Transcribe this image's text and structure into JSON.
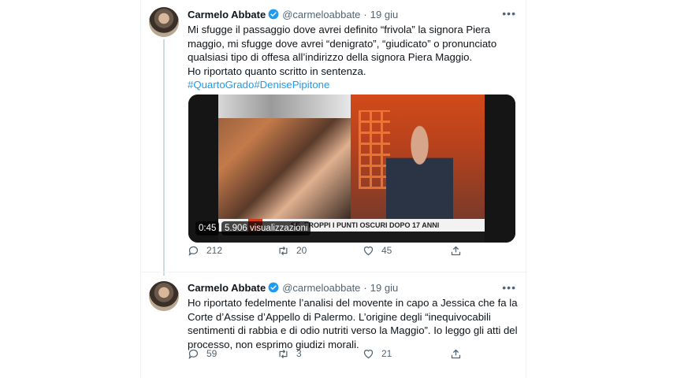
{
  "colors": {
    "accent": "#1d9bf0",
    "text": "#0f1419",
    "muted": "#536471"
  },
  "tweets": [
    {
      "author": {
        "name": "Carmelo Abbate",
        "handle": "@carmeloabbate",
        "verified": true
      },
      "date": "19 giu",
      "separator": "·",
      "more": "•••",
      "text_lines": [
        "Mi sfugge il passaggio dove avrei definito “frivola” la signora Piera",
        "maggio, mi sfugge dove avrei “denigrato”, “giudicato” o pronunciato",
        "qualsiasi tipo di offesa all’indirizzo della signora Piera Maggio.",
        "Ho riportato quanto scritto in sentenza."
      ],
      "hashtags": [
        "#QuartoGrado",
        "#DenisePipitone"
      ],
      "video": {
        "duration": "0:45",
        "views": "5.906 visualizzazioni",
        "banner": "SE, TROPPI I PUNTI OSCURI DOPO 17 ANNI"
      },
      "stats": {
        "replies": "212",
        "retweets": "20",
        "likes": "45"
      }
    },
    {
      "author": {
        "name": "Carmelo Abbate",
        "handle": "@carmeloabbate",
        "verified": true
      },
      "date": "19 giu",
      "separator": "·",
      "more": "•••",
      "text_lines": [
        "Ho riportato fedelmente l’analisi del movente in capo a Jessica che fa la",
        "Corte d’Assise d’Appello di Palermo. L’origine degli “inequivocabili",
        "sentimenti di rabbia e di odio nutriti verso la Maggio”. Io leggo gli atti del",
        "processo, non esprimo giudizi morali."
      ],
      "stats": {
        "replies": "59",
        "retweets": "3",
        "likes": "21"
      }
    }
  ],
  "icons": [
    "reply-icon",
    "retweet-icon",
    "like-icon",
    "share-icon",
    "verified-badge-icon",
    "more-icon"
  ]
}
